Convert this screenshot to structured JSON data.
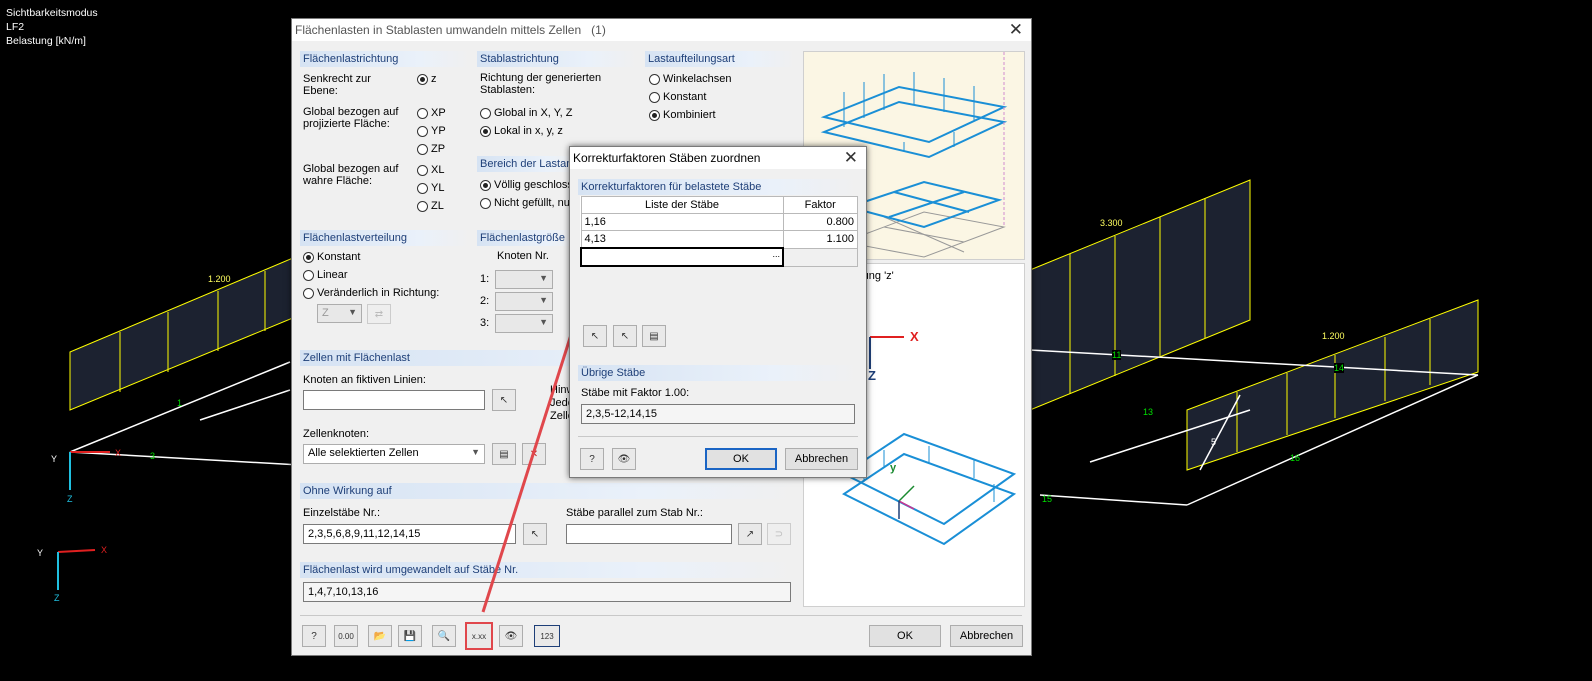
{
  "viewport": {
    "info_lines": [
      "Sichtbarkeitsmodus",
      "LF2",
      "Belastung [kN/m]"
    ],
    "load_labels": [
      "1.200",
      "3.300",
      "1.200"
    ],
    "member_labels": [
      "1",
      "3",
      "11",
      "13",
      "14",
      "15",
      "16",
      "5"
    ],
    "axis_labels": {
      "y": "Y",
      "x": "X",
      "z": "Z"
    }
  },
  "main_dialog": {
    "title": "Flächenlasten in Stablasten umwandeln mittels Zellen",
    "title_suffix": "(1)",
    "flaechenlastrichtung": {
      "header": "Flächenlastrichtung",
      "label_senkrecht": "Senkrecht zur Ebene:",
      "label_global_proj": "Global bezogen auf projizierte Fläche:",
      "label_global_wahr": "Global bezogen auf wahre Fläche:",
      "options": [
        "z",
        "XP",
        "YP",
        "ZP",
        "XL",
        "YL",
        "ZL"
      ],
      "selected": "z"
    },
    "stablastrichtung": {
      "header": "Stablastrichtung",
      "label": "Richtung der generierten Stablasten:",
      "options": [
        "Global in X, Y, Z",
        "Lokal in x, y, z"
      ],
      "selected": "Lokal in x, y, z"
    },
    "lastaufteilungsart": {
      "header": "Lastaufteilungsart",
      "options": [
        "Winkelachsen",
        "Konstant",
        "Kombiniert"
      ],
      "selected": "Kombiniert"
    },
    "bereich": {
      "header": "Bereich der Lastan",
      "options": [
        "Völlig geschlosse",
        "Nicht gefüllt, nu"
      ],
      "selected": "Völlig geschlosse"
    },
    "flaechenlastverteilung": {
      "header": "Flächenlastverteilung",
      "options": [
        "Konstant",
        "Linear",
        "Veränderlich in Richtung:"
      ],
      "selected": "Konstant",
      "direction_value": "Z"
    },
    "flaechenlastgroesse": {
      "header": "Flächenlastgröße",
      "col_header": "Knoten Nr.",
      "rows": [
        "1:",
        "2:",
        "3:"
      ]
    },
    "zellen": {
      "header": "Zellen mit Flächenlast",
      "label_knoten": "Knoten an fiktiven Linien:",
      "knoten_value": "",
      "hint_lines": [
        "Hinw",
        "Jede",
        "Zelle"
      ],
      "label_zellenknoten": "Zellenknoten:",
      "zellenknoten_value": "Alle selektierten Zellen"
    },
    "ohne_wirkung": {
      "header": "Ohne Wirkung auf",
      "label_einzel": "Einzelstäbe Nr.:",
      "einzel_value": "2,3,5,6,8,9,11,12,14,15",
      "label_parallel": "Stäbe parallel zum Stab Nr.:",
      "parallel_value": ""
    },
    "umgewandelt": {
      "header": "Flächenlast wird umgewandelt auf Stäbe Nr.",
      "value": "1,4,7,10,13,16"
    },
    "preview_text": "chtung 'z'",
    "preview_axes": {
      "x": "X",
      "z": "Z",
      "y": "y"
    },
    "ok_label": "OK",
    "cancel_label": "Abbrechen",
    "toolbar_icons": [
      "help-icon",
      "units-icon",
      "open-icon",
      "save-icon",
      "zoom-icon",
      "correction-factors-icon",
      "visibility-icon",
      "numbering-icon"
    ],
    "units_text": "0.00",
    "xxx_text": "x.xx",
    "num_text": "123"
  },
  "sub_dialog": {
    "title": "Korrekturfaktoren Stäben zuordnen",
    "group_header": "Korrekturfaktoren für belastete Stäbe",
    "columns": [
      "Liste der Stäbe",
      "Faktor"
    ],
    "rows": [
      {
        "list": "1,16",
        "factor": "0.800"
      },
      {
        "list": "4,13",
        "factor": "1.100"
      }
    ],
    "edit_row_value": "",
    "uebrige_header": "Übrige Stäbe",
    "uebrige_label": "Stäbe mit Faktor 1.00:",
    "uebrige_value": "2,3,5-12,14,15",
    "ok_label": "OK",
    "cancel_label": "Abbrechen"
  },
  "colors": {
    "accent": "#1e3f78",
    "highlight_arrow": "#e0474c",
    "load_yellow": "#ffff00",
    "member_white": "#ffffff",
    "default_button_border": "#1b65c4"
  }
}
